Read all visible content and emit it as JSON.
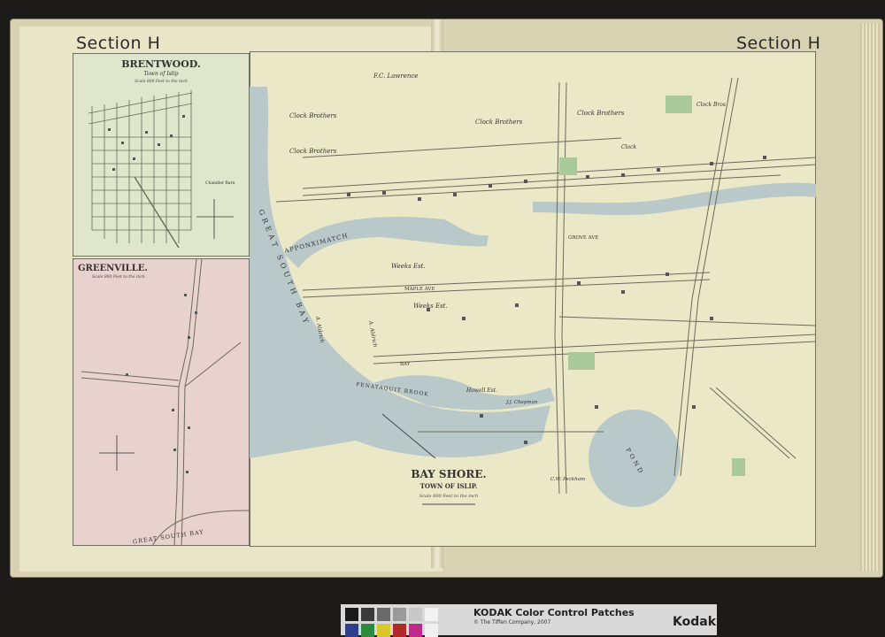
{
  "atlas": {
    "section_left": "Section H",
    "section_right": "Section H"
  },
  "brentwood": {
    "title": "BRENTWOOD.",
    "subtitle": "Town of Islip",
    "scale": "Scale 800 Feet to the inch",
    "landmark": "Chandler Barn"
  },
  "greenville": {
    "title": "GREENVILLE.",
    "scale": "Scale 800 Feet to the inch",
    "bay": "GREAT SOUTH BAY"
  },
  "bayshore": {
    "title": "BAY SHORE.",
    "town": "TOWN OF ISLIP.",
    "scale": "Scale 800 Feet to the inch",
    "water": {
      "great_south_bay": "GREAT SOUTH BAY",
      "apponximatch": "APPONXIMATCH",
      "penataquit": "PENATAQUIT BROOK",
      "pond": "POND"
    },
    "streets": {
      "maple": "MAPLE AVE",
      "grove": "GROVE AVE",
      "bay": "BAY"
    },
    "owners": {
      "lawrence": "F.C. Lawrence",
      "clock1": "Clock Brothers",
      "clock2": "Clock Brothers",
      "clock3": "Clock Brothers",
      "clock4": "Clock Brothers",
      "clock5": "Clock Bros",
      "clock_field": "Clock",
      "weeks1": "Weeks Est.",
      "weeks2": "Weeks Est.",
      "howell": "Howell Est.",
      "aldrich1": "A. Aldrich",
      "aldrich2": "A. Aldrich",
      "chapman": "J.J. Chapman",
      "peckham": "C.W. Peckham"
    }
  },
  "kodak": {
    "title": "KODAK Color Control Patches",
    "subtitle": "© The Tiffen Company, 2007",
    "brand": "Kodak",
    "patch_colors": [
      "#1a1a1a",
      "#3b3b3b",
      "#6a6a6a",
      "#9a9a9a",
      "#c8c8c8",
      "#f2f2f2"
    ],
    "color_patches": [
      "#2f3f8a",
      "#2e8a3e",
      "#d8c82a",
      "#b02a2a",
      "#c02a8a",
      "#f0f0f0"
    ]
  }
}
